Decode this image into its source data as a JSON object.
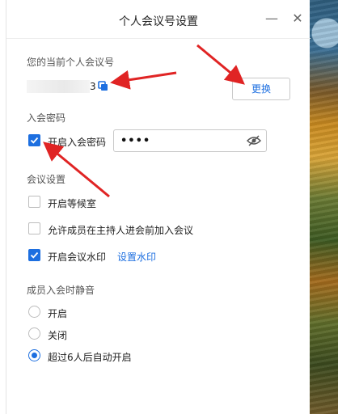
{
  "dialog": {
    "title": "个人会议号设置"
  },
  "meeting_number": {
    "label": "您的当前个人会议号",
    "visible_digit": "3",
    "change_button": "更换"
  },
  "password": {
    "section_label": "入会密码",
    "enable_label": "开启入会密码",
    "enabled": true,
    "value": "••••"
  },
  "meeting_settings": {
    "section_label": "会议设置",
    "waiting_room": {
      "label": "开启等候室",
      "checked": false
    },
    "join_before_host": {
      "label": "允许成员在主持人进会前加入会议",
      "checked": false
    },
    "watermark": {
      "label": "开启会议水印",
      "checked": true,
      "link": "设置水印"
    }
  },
  "mute_on_join": {
    "section_label": "成员入会时静音",
    "options": [
      {
        "label": "开启",
        "selected": false
      },
      {
        "label": "关闭",
        "selected": false
      },
      {
        "label": "超过6人后自动开启",
        "selected": true
      }
    ]
  },
  "colors": {
    "accent": "#1d6fe0",
    "annotation_arrow": "#e02424"
  },
  "icons": {
    "minimize": "minimize-icon",
    "close": "close-icon",
    "copy": "copy-icon",
    "eye_hidden": "eye-off-icon",
    "check": "check-icon"
  }
}
